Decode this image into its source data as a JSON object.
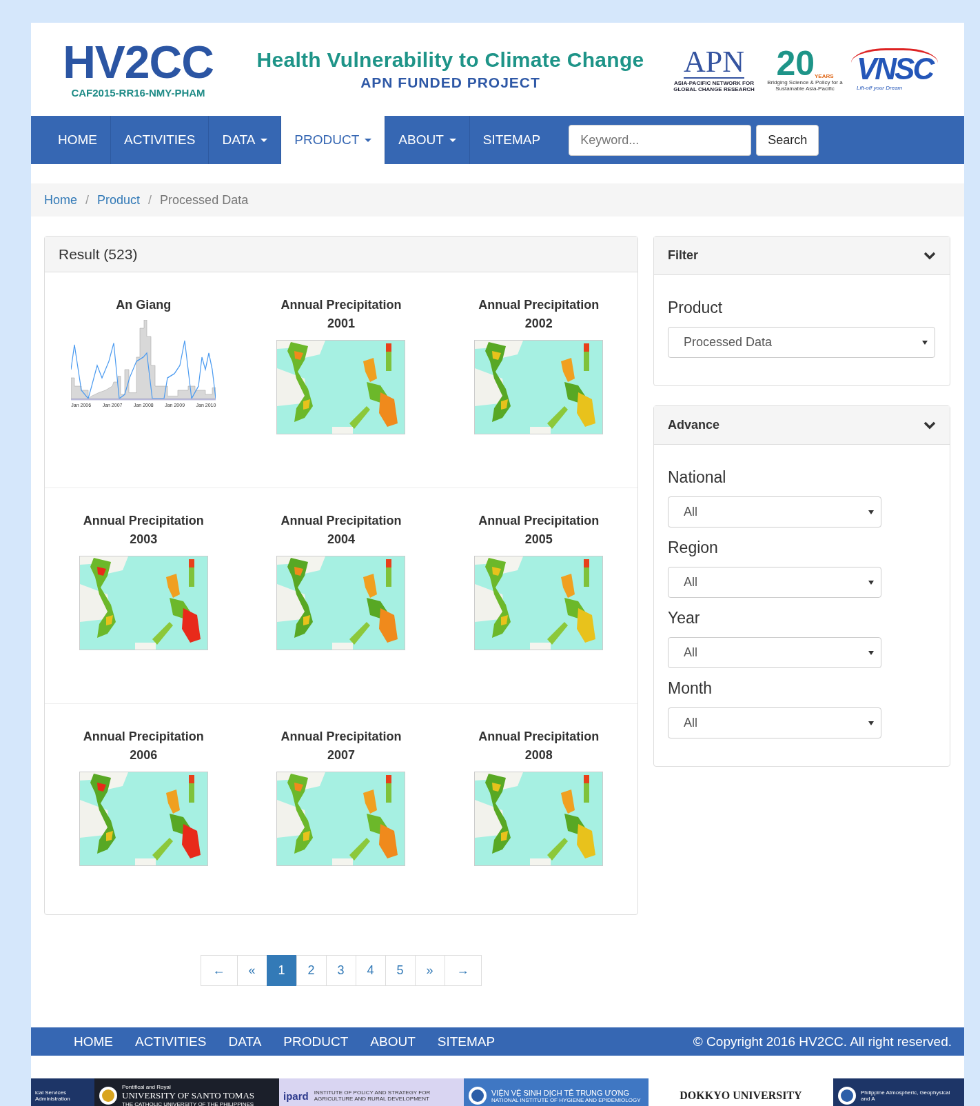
{
  "header": {
    "logo": "HV2CC",
    "code": "CAF2015-RR16-NMY-PHAM",
    "title": "Health Vulnerability to Climate Change",
    "subtitle": "APN FUNDED PROJECT",
    "partners": [
      {
        "kind": "apn",
        "name": "APN",
        "caption": "ASIA-PACIFIC NETWORK FOR GLOBAL CHANGE RESEARCH"
      },
      {
        "kind": "years",
        "name": "20",
        "badge": "YEARS",
        "caption": "Bridging Science & Policy for a Sustainable Asia-Pacific"
      },
      {
        "kind": "vnsc",
        "name": "VNSC",
        "caption": "Lift-off your Dream"
      }
    ]
  },
  "nav": {
    "items": [
      {
        "label": "HOME",
        "dropdown": false,
        "selected": false
      },
      {
        "label": "ACTIVITIES",
        "dropdown": false,
        "selected": false
      },
      {
        "label": "DATA",
        "dropdown": true,
        "selected": false
      },
      {
        "label": "PRODUCT",
        "dropdown": true,
        "selected": true
      },
      {
        "label": "ABOUT",
        "dropdown": true,
        "selected": false
      },
      {
        "label": "SITEMAP",
        "dropdown": false,
        "selected": false
      }
    ],
    "search": {
      "placeholder": "Keyword...",
      "button": "Search"
    }
  },
  "breadcrumb": [
    {
      "label": "Home",
      "link": true,
      "separator": "/"
    },
    {
      "label": "Product",
      "link": true,
      "separator": "/"
    },
    {
      "label": "Processed Data",
      "link": false
    }
  ],
  "results": {
    "title": "Result (523)",
    "items": [
      {
        "title": "An Giang",
        "kind": "chart",
        "axis_labels": [
          "Jan 2006",
          "Jan 2007",
          "Jan 2008",
          "Jan 2009",
          "Jan 2010"
        ]
      },
      {
        "title": "Annual Precipitation 2001",
        "kind": "map"
      },
      {
        "title": "Annual Precipitation 2002",
        "kind": "map"
      },
      {
        "title": "Annual Precipitation 2003",
        "kind": "map"
      },
      {
        "title": "Annual Precipitation 2004",
        "kind": "map"
      },
      {
        "title": "Annual Precipitation 2005",
        "kind": "map"
      },
      {
        "title": "Annual Precipitation 2006",
        "kind": "map"
      },
      {
        "title": "Annual Precipitation 2007",
        "kind": "map"
      },
      {
        "title": "Annual Precipitation 2008",
        "kind": "map"
      }
    ]
  },
  "pagination": [
    {
      "label": "←",
      "selected": false
    },
    {
      "label": "«",
      "selected": false
    },
    {
      "label": "1",
      "selected": true
    },
    {
      "label": "2",
      "selected": false
    },
    {
      "label": "3",
      "selected": false
    },
    {
      "label": "4",
      "selected": false
    },
    {
      "label": "5",
      "selected": false
    },
    {
      "label": "»",
      "selected": false
    },
    {
      "label": "→",
      "selected": false
    }
  ],
  "filter": {
    "title": "Filter",
    "fields": [
      {
        "label": "Product",
        "value": "Processed Data"
      }
    ]
  },
  "advance": {
    "title": "Advance",
    "fields": [
      {
        "label": "National",
        "value": "All"
      },
      {
        "label": "Region",
        "value": "All"
      },
      {
        "label": "Year",
        "value": "All"
      },
      {
        "label": "Month",
        "value": "All"
      }
    ]
  },
  "footer": {
    "links": [
      "HOME",
      "ACTIVITIES",
      "DATA",
      "PRODUCT",
      "ABOUT",
      "SITEMAP"
    ],
    "copyright": "© Copyright 2016 HV2CC. All right reserved."
  },
  "sponsors": [
    {
      "kind": "navy",
      "lines": [
        "ical Services Administration"
      ]
    },
    {
      "kind": "dark",
      "lines": [
        "Pontifical and Royal",
        "UNIVERSITY OF SANTO TOMAS",
        "THE CATHOLIC UNIVERSITY OF THE PHILIPPINES"
      ]
    },
    {
      "kind": "light",
      "lines": [
        "ipard",
        "INSTITUTE OF POLICY AND STRATEGY FOR AGRICULTURE AND RURAL DEVELOPMENT"
      ]
    },
    {
      "kind": "blue",
      "lines": [
        "VIỆN VỆ SINH DỊCH TỄ TRUNG ƯƠNG",
        "NATIONAL INSTITUTE OF HYGIENE AND EPIDEMIOLOGY"
      ]
    },
    {
      "kind": "white",
      "lines": [
        "DOKKYO UNIVERSITY"
      ]
    },
    {
      "kind": "navy",
      "lines": [
        "Philippine Atmospheric, Geophysical and A"
      ]
    }
  ]
}
